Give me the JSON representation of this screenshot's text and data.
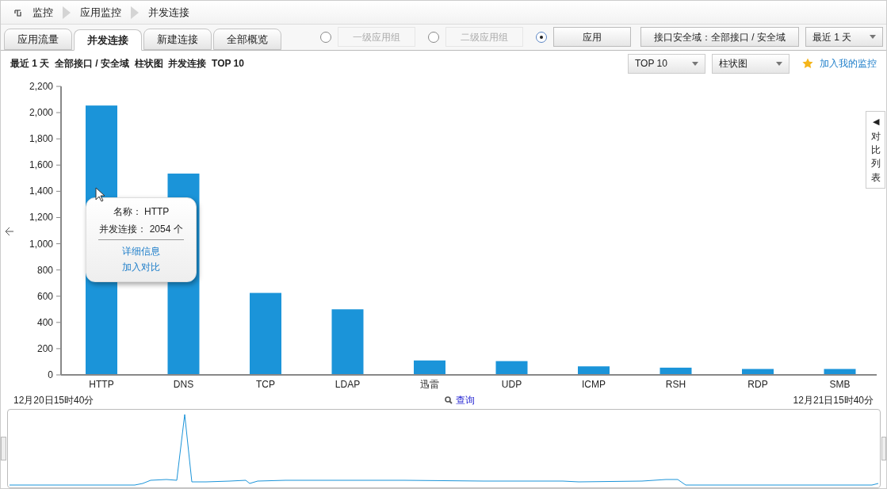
{
  "breadcrumb": [
    "监控",
    "应用监控",
    "并发连接"
  ],
  "tabs": [
    {
      "label": "应用流量",
      "selected": false
    },
    {
      "label": "并发连接",
      "selected": true
    },
    {
      "label": "新建连接",
      "selected": false
    },
    {
      "label": "全部概览",
      "selected": false
    }
  ],
  "group_options": [
    {
      "label": "一级应用组",
      "selected": false,
      "disabled": true
    },
    {
      "label": "二级应用组",
      "selected": false,
      "disabled": true
    },
    {
      "label": "应用",
      "selected": true,
      "disabled": false
    }
  ],
  "interface_button": "接口安全域：全部接口 / 安全域",
  "period_select": "最近 1 天",
  "summary": "最近 1 天  全部接口 / 安全域  柱状图  并发连接  TOP 10",
  "top_select": "TOP 10",
  "chart_type_select": "柱状图",
  "add_monitor": "加入我的监控",
  "compare_panel": {
    "arrow": "◀",
    "label": "对比列表"
  },
  "chart_data": {
    "type": "bar",
    "categories": [
      "HTTP",
      "DNS",
      "TCP",
      "LDAP",
      "迅雷",
      "UDP",
      "ICMP",
      "RSH",
      "RDP",
      "SMB"
    ],
    "series": [
      {
        "color": "#1b94d9",
        "values": [
          2054,
          1535,
          625,
          500,
          110,
          105,
          65,
          55,
          45,
          45
        ]
      }
    ],
    "ylim": [
      0,
      2200
    ],
    "yticks": [
      0,
      {
        "value": 200,
        "label": "200"
      },
      {
        "value": 400,
        "label": "400"
      },
      {
        "value": 600,
        "label": "600"
      },
      {
        "value": 800,
        "label": "800"
      },
      {
        "value": 1000,
        "label": "1,000"
      },
      {
        "value": 1200,
        "label": "1,200"
      },
      {
        "value": 1400,
        "label": "1,400"
      },
      {
        "value": 1600,
        "label": "1,600"
      },
      {
        "value": 1800,
        "label": "1,800"
      },
      {
        "value": 2000,
        "label": "2,000"
      },
      {
        "value": 2200,
        "label": "2,200"
      }
    ]
  },
  "tooltip": {
    "name_line": "名称： HTTP",
    "value_line": "并发连接： 2054 个",
    "links": [
      "详细信息",
      "加入对比"
    ]
  },
  "timeline": {
    "start": "12月20日15时40分",
    "query": "查询",
    "end": "12月21日15时40分"
  }
}
